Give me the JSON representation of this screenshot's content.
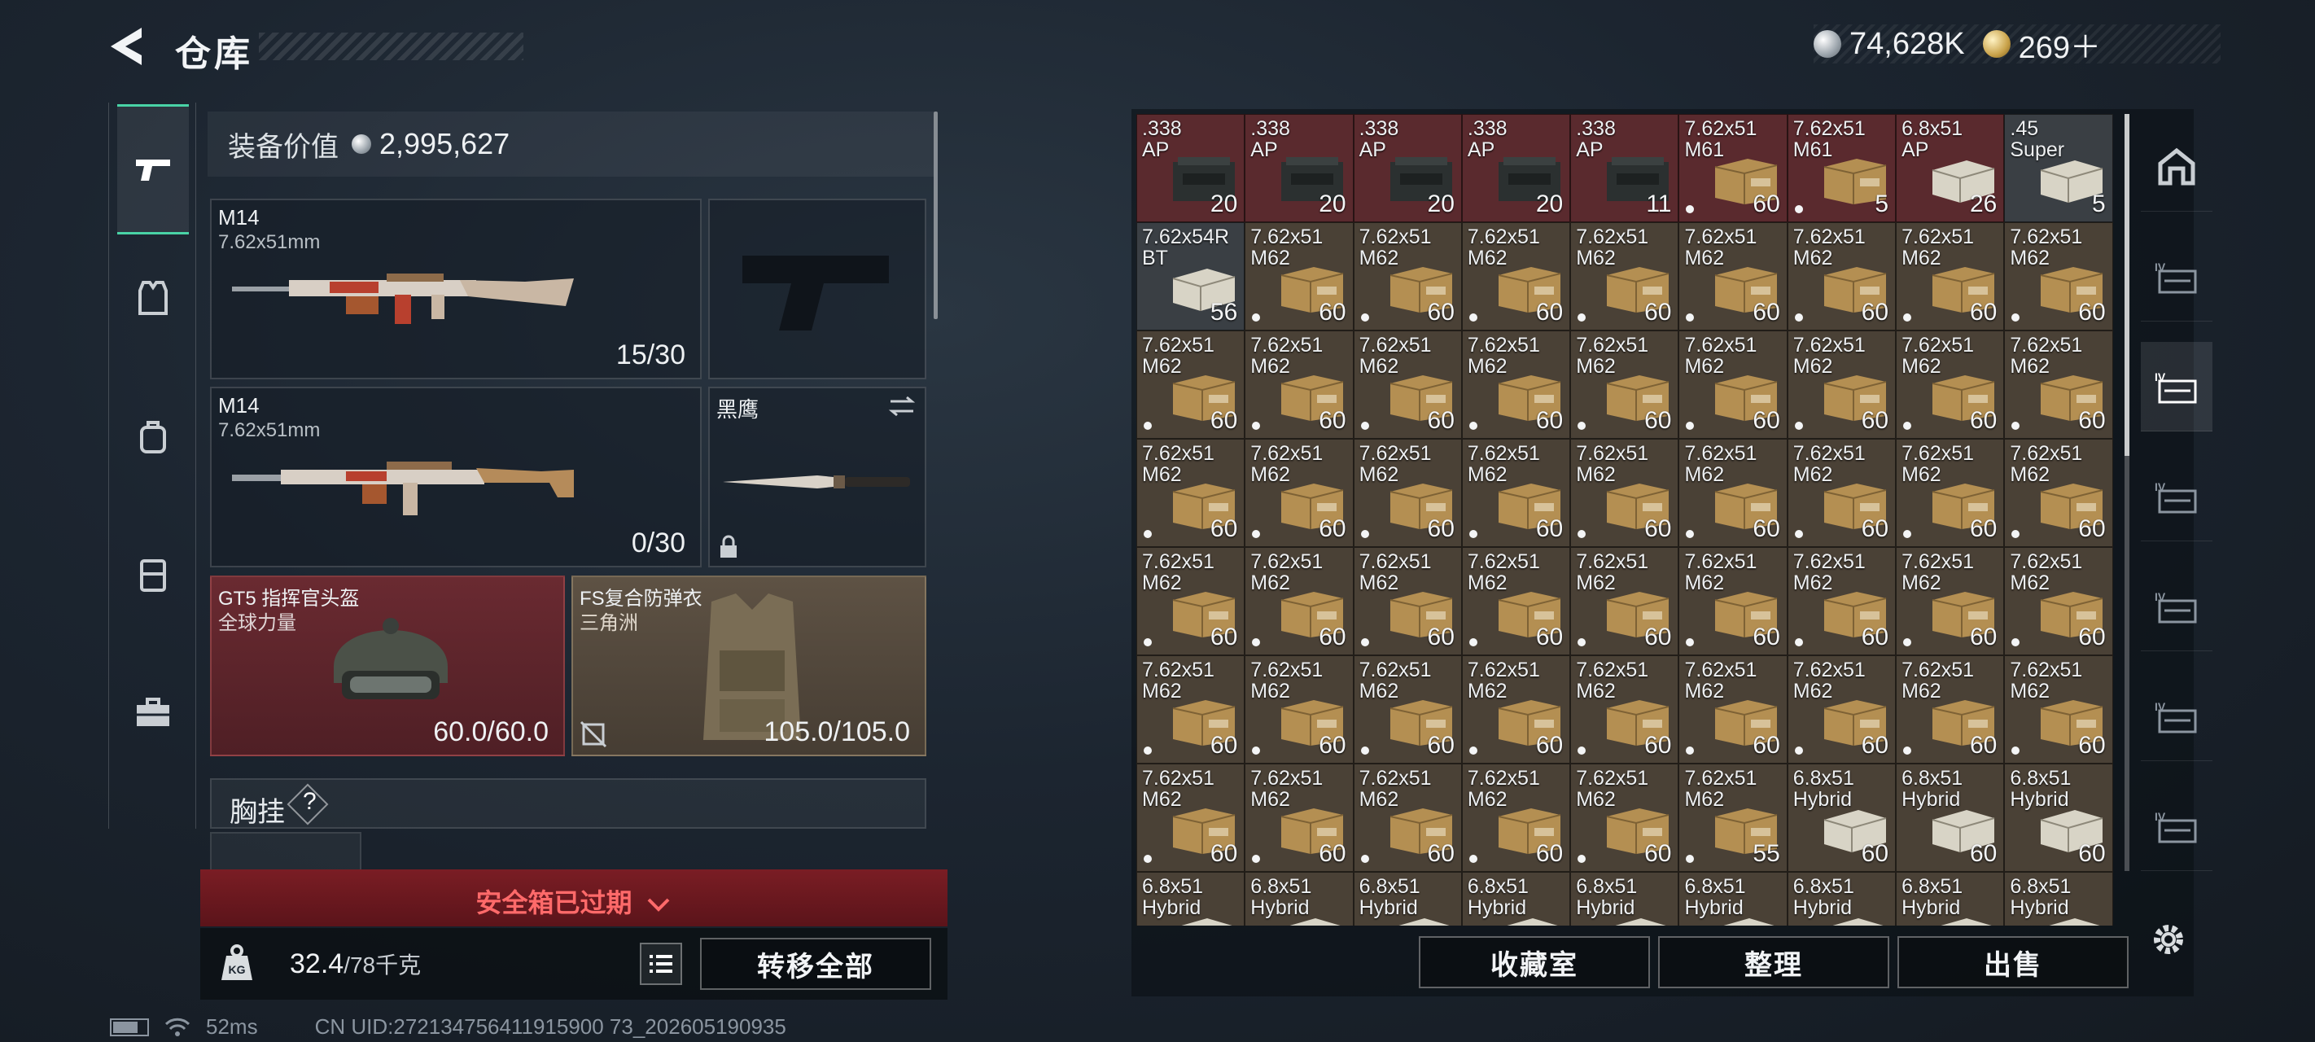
{
  "header": {
    "title": "仓库"
  },
  "currency": {
    "silver": "74,628K",
    "gold": "269＋"
  },
  "equipment": {
    "value_label": "装备价值",
    "value": "2,995,627",
    "primary1": {
      "name": "M14",
      "caliber": "7.62x51mm",
      "ammo": "15/30"
    },
    "primary2": {
      "name": "M14",
      "caliber": "7.62x51mm",
      "ammo": "0/30"
    },
    "melee": {
      "name": "黑鹰"
    },
    "helmet": {
      "name": "GT5 指挥官头盔",
      "faction": "全球力量",
      "durability": "60.0/60.0"
    },
    "armor": {
      "name": "FS复合防弹衣",
      "faction": "三角洲",
      "durability": "105.0/105.0"
    },
    "chest_rig": {
      "label": "胸挂",
      "hint": "?"
    }
  },
  "safe_box": {
    "expired_label": "安全箱已过期"
  },
  "weight": {
    "current": "32.4",
    "capacity": "/78千克"
  },
  "actions": {
    "transfer_all": "转移全部",
    "collection": "收藏室",
    "sort": "整理",
    "sell": "出售"
  },
  "status": {
    "ping": "52ms",
    "uid": "CN UID:272134756411915900 73_202605190935"
  },
  "inventory": [
    {
      "name": ".338\nAP",
      "count": "20",
      "bg": "red",
      "box": "ammo-case"
    },
    {
      "name": ".338\nAP",
      "count": "20",
      "bg": "red",
      "box": "ammo-case"
    },
    {
      "name": ".338\nAP",
      "count": "20",
      "bg": "red",
      "box": "ammo-case"
    },
    {
      "name": ".338\nAP",
      "count": "20",
      "bg": "red",
      "box": "ammo-case"
    },
    {
      "name": ".338\nAP",
      "count": "11",
      "bg": "red",
      "box": "ammo-case"
    },
    {
      "name": "7.62x51\nM61",
      "count": "60",
      "bg": "red",
      "box": "carton",
      "dot": true
    },
    {
      "name": "7.62x51\nM61",
      "count": "5",
      "bg": "red",
      "box": "carton",
      "dot": true
    },
    {
      "name": "6.8x51\nAP",
      "count": "26",
      "bg": "red",
      "box": "white-box"
    },
    {
      "name": ".45\nSuper",
      "count": "5",
      "bg": "grey",
      "box": "white-box"
    },
    {
      "name": "7.62x54R\nBT",
      "count": "56",
      "bg": "grey",
      "box": "white-box"
    },
    {
      "name": "7.62x51\nM62",
      "count": "60",
      "bg": "tan",
      "box": "carton",
      "dot": true
    },
    {
      "name": "7.62x51\nM62",
      "count": "60",
      "bg": "tan",
      "box": "carton",
      "dot": true
    },
    {
      "name": "7.62x51\nM62",
      "count": "60",
      "bg": "tan",
      "box": "carton",
      "dot": true
    },
    {
      "name": "7.62x51\nM62",
      "count": "60",
      "bg": "tan",
      "box": "carton",
      "dot": true
    },
    {
      "name": "7.62x51\nM62",
      "count": "60",
      "bg": "tan",
      "box": "carton",
      "dot": true
    },
    {
      "name": "7.62x51\nM62",
      "count": "60",
      "bg": "tan",
      "box": "carton",
      "dot": true
    },
    {
      "name": "7.62x51\nM62",
      "count": "60",
      "bg": "tan",
      "box": "carton",
      "dot": true
    },
    {
      "name": "7.62x51\nM62",
      "count": "60",
      "bg": "tan",
      "box": "carton",
      "dot": true
    },
    {
      "name": "7.62x51\nM62",
      "count": "60",
      "bg": "tan",
      "box": "carton",
      "dot": true
    },
    {
      "name": "7.62x51\nM62",
      "count": "60",
      "bg": "tan",
      "box": "carton",
      "dot": true
    },
    {
      "name": "7.62x51\nM62",
      "count": "60",
      "bg": "tan",
      "box": "carton",
      "dot": true
    },
    {
      "name": "7.62x51\nM62",
      "count": "60",
      "bg": "tan",
      "box": "carton",
      "dot": true
    },
    {
      "name": "7.62x51\nM62",
      "count": "60",
      "bg": "tan",
      "box": "carton",
      "dot": true
    },
    {
      "name": "7.62x51\nM62",
      "count": "60",
      "bg": "tan",
      "box": "carton",
      "dot": true
    },
    {
      "name": "7.62x51\nM62",
      "count": "60",
      "bg": "tan",
      "box": "carton",
      "dot": true
    },
    {
      "name": "7.62x51\nM62",
      "count": "60",
      "bg": "tan",
      "box": "carton",
      "dot": true
    },
    {
      "name": "7.62x51\nM62",
      "count": "60",
      "bg": "tan",
      "box": "carton",
      "dot": true
    },
    {
      "name": "7.62x51\nM62",
      "count": "60",
      "bg": "tan",
      "box": "carton",
      "dot": true
    },
    {
      "name": "7.62x51\nM62",
      "count": "60",
      "bg": "tan",
      "box": "carton",
      "dot": true
    },
    {
      "name": "7.62x51\nM62",
      "count": "60",
      "bg": "tan",
      "box": "carton",
      "dot": true
    },
    {
      "name": "7.62x51\nM62",
      "count": "60",
      "bg": "tan",
      "box": "carton",
      "dot": true
    },
    {
      "name": "7.62x51\nM62",
      "count": "60",
      "bg": "tan",
      "box": "carton",
      "dot": true
    },
    {
      "name": "7.62x51\nM62",
      "count": "60",
      "bg": "tan",
      "box": "carton",
      "dot": true
    },
    {
      "name": "7.62x51\nM62",
      "count": "60",
      "bg": "tan",
      "box": "carton",
      "dot": true
    },
    {
      "name": "7.62x51\nM62",
      "count": "60",
      "bg": "tan",
      "box": "carton",
      "dot": true
    },
    {
      "name": "7.62x51\nM62",
      "count": "60",
      "bg": "tan",
      "box": "carton",
      "dot": true
    },
    {
      "name": "7.62x51\nM62",
      "count": "60",
      "bg": "tan",
      "box": "carton",
      "dot": true
    },
    {
      "name": "7.62x51\nM62",
      "count": "60",
      "bg": "tan",
      "box": "carton",
      "dot": true
    },
    {
      "name": "7.62x51\nM62",
      "count": "60",
      "bg": "tan",
      "box": "carton",
      "dot": true
    },
    {
      "name": "7.62x51\nM62",
      "count": "60",
      "bg": "tan",
      "box": "carton",
      "dot": true
    },
    {
      "name": "7.62x51\nM62",
      "count": "60",
      "bg": "tan",
      "box": "carton",
      "dot": true
    },
    {
      "name": "7.62x51\nM62",
      "count": "60",
      "bg": "tan",
      "box": "carton",
      "dot": true
    },
    {
      "name": "7.62x51\nM62",
      "count": "60",
      "bg": "tan",
      "box": "carton",
      "dot": true
    },
    {
      "name": "7.62x51\nM62",
      "count": "60",
      "bg": "tan",
      "box": "carton",
      "dot": true
    },
    {
      "name": "7.62x51\nM62",
      "count": "60",
      "bg": "tan",
      "box": "carton",
      "dot": true
    },
    {
      "name": "7.62x51\nM62",
      "count": "60",
      "bg": "tan",
      "box": "carton",
      "dot": true
    },
    {
      "name": "7.62x51\nM62",
      "count": "60",
      "bg": "tan",
      "box": "carton",
      "dot": true
    },
    {
      "name": "7.62x51\nM62",
      "count": "60",
      "bg": "tan",
      "box": "carton",
      "dot": true
    },
    {
      "name": "7.62x51\nM62",
      "count": "60",
      "bg": "tan",
      "box": "carton",
      "dot": true
    },
    {
      "name": "7.62x51\nM62",
      "count": "60",
      "bg": "tan",
      "box": "carton",
      "dot": true
    },
    {
      "name": "7.62x51\nM62",
      "count": "60",
      "bg": "tan",
      "box": "carton",
      "dot": true
    },
    {
      "name": "7.62x51\nM62",
      "count": "60",
      "bg": "tan",
      "box": "carton",
      "dot": true
    },
    {
      "name": "7.62x51\nM62",
      "count": "60",
      "bg": "tan",
      "box": "carton",
      "dot": true
    },
    {
      "name": "7.62x51\nM62",
      "count": "60",
      "bg": "tan",
      "box": "carton",
      "dot": true
    },
    {
      "name": "7.62x51\nM62",
      "count": "60",
      "bg": "tan",
      "box": "carton",
      "dot": true
    },
    {
      "name": "7.62x51\nM62",
      "count": "60",
      "bg": "tan",
      "box": "carton",
      "dot": true
    },
    {
      "name": "7.62x51\nM62",
      "count": "60",
      "bg": "tan",
      "box": "carton",
      "dot": true
    },
    {
      "name": "7.62x51\nM62",
      "count": "60",
      "bg": "tan",
      "box": "carton",
      "dot": true
    },
    {
      "name": "7.62x51\nM62",
      "count": "60",
      "bg": "tan",
      "box": "carton",
      "dot": true
    },
    {
      "name": "7.62x51\nM62",
      "count": "55",
      "bg": "tan",
      "box": "carton",
      "dot": true
    },
    {
      "name": "6.8x51\nHybrid",
      "count": "60",
      "bg": "tan",
      "box": "white-box"
    },
    {
      "name": "6.8x51\nHybrid",
      "count": "60",
      "bg": "tan",
      "box": "white-box"
    },
    {
      "name": "6.8x51\nHybrid",
      "count": "60",
      "bg": "tan",
      "box": "white-box"
    },
    {
      "name": "6.8x51\nHybrid",
      "count": "",
      "bg": "tan",
      "box": "white-box"
    },
    {
      "name": "6.8x51\nHybrid",
      "count": "",
      "bg": "tan",
      "box": "white-box"
    },
    {
      "name": "6.8x51\nHybrid",
      "count": "",
      "bg": "tan",
      "box": "white-box"
    },
    {
      "name": "6.8x51\nHybrid",
      "count": "",
      "bg": "tan",
      "box": "white-box"
    },
    {
      "name": "6.8x51\nHybrid",
      "count": "",
      "bg": "tan",
      "box": "white-box"
    },
    {
      "name": "6.8x51\nHybrid",
      "count": "",
      "bg": "tan",
      "box": "white-box"
    },
    {
      "name": "6.8x51\nHybrid",
      "count": "",
      "bg": "tan",
      "box": "white-box"
    },
    {
      "name": "6.8x51\nHybrid",
      "count": "",
      "bg": "tan",
      "box": "white-box"
    },
    {
      "name": "6.8x51\nHybrid",
      "count": "",
      "bg": "tan",
      "box": "white-box"
    }
  ],
  "stash_tabs": [
    {
      "icon": "stash-home-icon",
      "active": false
    },
    {
      "icon": "stash-case-iv-icon",
      "active": false
    },
    {
      "icon": "stash-case-iv-active-icon",
      "active": true
    },
    {
      "icon": "stash-case-iv-icon",
      "active": false
    },
    {
      "icon": "stash-case-iv-icon",
      "active": false
    },
    {
      "icon": "stash-case-iv-icon",
      "active": false
    },
    {
      "icon": "stash-case-iv-icon",
      "active": false
    }
  ]
}
